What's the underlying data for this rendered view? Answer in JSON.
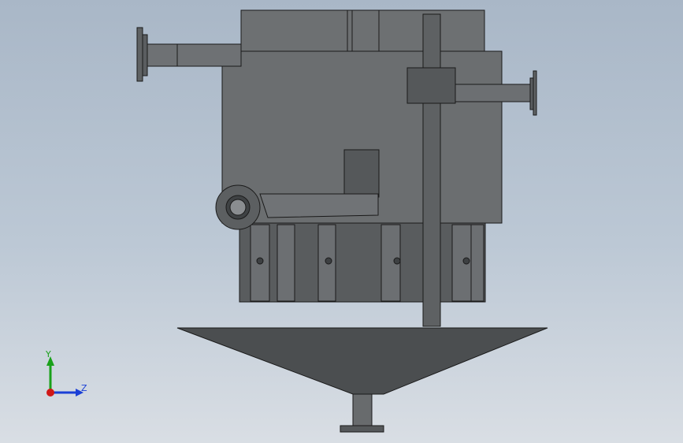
{
  "viewport": {
    "background_top": "#a9b7c7",
    "background_bottom": "#d9dee4"
  },
  "model": {
    "body_color": "#6a6d6f",
    "dark_color": "#4b4e50",
    "edge_color": "#1a1a1a"
  },
  "triad": {
    "y_label": "Y",
    "z_label": "Z",
    "y_color": "#1aa11a",
    "z_color": "#1a3fd6",
    "x_color": "#d01818"
  }
}
